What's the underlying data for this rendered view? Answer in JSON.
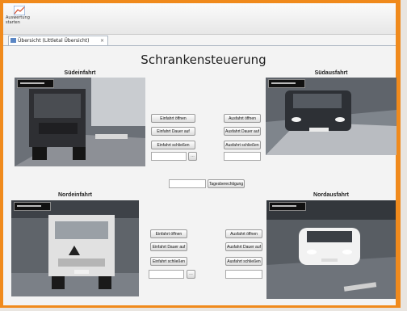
{
  "toolbar": {
    "button_label": "Auswertung starten",
    "icon": "chart-icon"
  },
  "tab": {
    "label": "Übersicht (Littletal Übersicht)",
    "close": "×",
    "icon": "grid-icon"
  },
  "title": "Schrankensteuerung",
  "cameras": {
    "suedeinfahrt": "Südeinfahrt",
    "suedausfahrt": "Südausfahrt",
    "nordeinfahrt": "Nordeinfahrt",
    "nordausfahrt": "Nordausfahrt"
  },
  "controls": {
    "sued_einfahrt": {
      "open": "Einfahrt öffnen",
      "permanent": "Einfahrt Dauer auf",
      "close": "Einfahrt schließen"
    },
    "sued_ausfahrt": {
      "open": "Ausfahrt öffnen",
      "permanent": "Ausfahrt Dauer auf",
      "close": "Ausfahrt schließen"
    },
    "nord_einfahrt": {
      "open": "Einfahrt öffnen",
      "permanent": "Einfahrt Dauer auf",
      "close": "Einfahrt schließen"
    },
    "nord_ausfahrt": {
      "open": "Ausfahrt öffnen",
      "permanent": "Ausfahrt Dauer auf",
      "close": "Ausfahrt schließen"
    },
    "ellipsis": "...",
    "day_permit": "Tagesberechtigung"
  },
  "colors": {
    "frame": "#f08a1c",
    "accent": "#5a86c4"
  }
}
